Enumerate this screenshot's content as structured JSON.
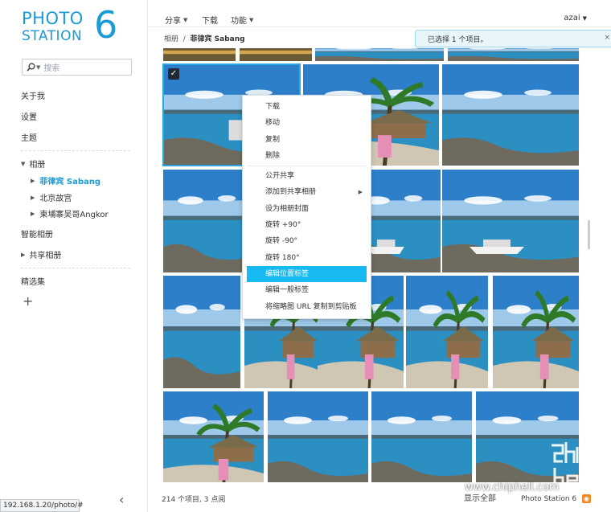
{
  "app": {
    "logo_line1": "PHOTO",
    "logo_line2": "STATION",
    "logo_version": "6",
    "brand_color": "#1a9bd6"
  },
  "sidebar": {
    "search_placeholder": "搜索",
    "items": [
      {
        "label": "关于我"
      },
      {
        "label": "设置"
      },
      {
        "label": "主题"
      }
    ],
    "albums_label": "相册",
    "albums": [
      {
        "label": "菲律宾 Sabang",
        "active": true
      },
      {
        "label": "北京故宫"
      },
      {
        "label": "柬埔寨吴哥Angkor"
      }
    ],
    "smart_album": "智能相册",
    "shared_album": "共享相册",
    "featured": "精选集"
  },
  "toolbar": {
    "share": "分享",
    "download": "下载",
    "function": "功能",
    "user": "azai"
  },
  "breadcrumb": {
    "root": "相册",
    "separator": "/",
    "current": "菲律宾 Sabang"
  },
  "notification": {
    "text": "已选择 1 个项目。",
    "close": "×"
  },
  "context_menu": {
    "items": [
      {
        "label": "下载"
      },
      {
        "label": "移动"
      },
      {
        "label": "复制"
      },
      {
        "label": "删除"
      },
      {
        "label": "公开共享"
      },
      {
        "label": "添加到共享相册",
        "submenu": true
      },
      {
        "label": "设为相册封面"
      },
      {
        "label": "旋转 +90°"
      },
      {
        "label": "旋转 -90°"
      },
      {
        "label": "旋转 180°"
      },
      {
        "label": "编辑位置标签",
        "highlighted": true
      },
      {
        "label": "编辑一般标签"
      },
      {
        "label": "将缩略图 URL 复制到剪贴板"
      }
    ]
  },
  "footer": {
    "count": "214 个项目, 3 点阅",
    "show_all": "显示全部",
    "brand": "Photo Station 6"
  },
  "status_url": "192.168.1.20/photo/#",
  "watermark": "www.chiphell.com"
}
